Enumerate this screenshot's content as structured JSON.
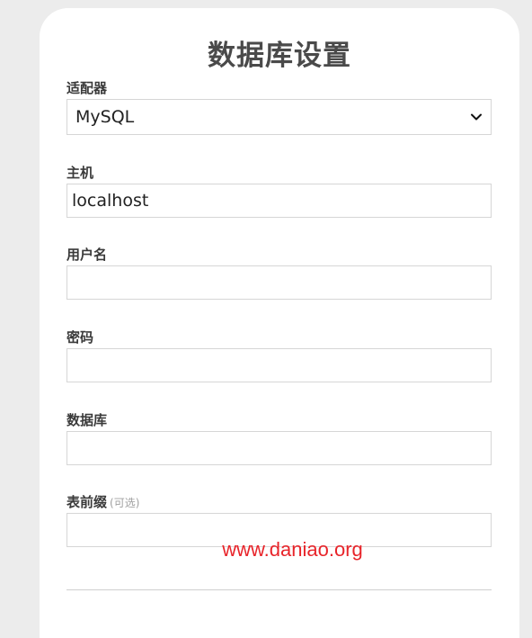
{
  "page": {
    "title": "数据库设置"
  },
  "fields": {
    "adapter": {
      "label": "适配器",
      "value": "MySQL"
    },
    "host": {
      "label": "主机",
      "value": "localhost"
    },
    "username": {
      "label": "用户名",
      "value": ""
    },
    "password": {
      "label": "密码",
      "value": ""
    },
    "database": {
      "label": "数据库",
      "value": ""
    },
    "table_prefix": {
      "label": "表前缀",
      "optional_hint": "(可选)",
      "value": ""
    }
  },
  "watermark": {
    "text": "www.daniao.org",
    "color": "#e8242a"
  },
  "colors": {
    "background": "#ececec",
    "card": "#ffffff",
    "border": "#d6d6d6",
    "title": "#4a4a4a"
  },
  "icons": {
    "dropdown": "chevron-down-icon"
  }
}
